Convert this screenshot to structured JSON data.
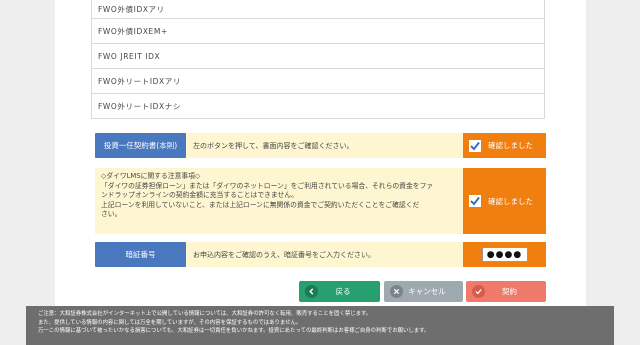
{
  "funds": [
    "FWO外債IDXアリ",
    "FWO外債IDXEM+",
    "FWO JREIT IDX",
    "FWO外リートIDXアリ",
    "FWO外リートIDXナシ"
  ],
  "contract_row": {
    "label": "投資一任契約書(本則)",
    "text": "左のボタンを押して、書面内容をご確認ください。",
    "confirm_label": "確認しました"
  },
  "notice_row": {
    "lines": [
      "◇ダイワLMSに関する注意事項◇",
      "「ダイワの証券担保ローン」または「ダイワのネットローン」をご利用されている場合、それらの資金をファ",
      "ンドラップオンラインの契約金額に充当することはできません。",
      "上記ローンを利用していないこと、または上記ローンに無関係の資金でご契約いただくことをご確認くだ",
      "さい。"
    ],
    "confirm_label": "確認しました"
  },
  "pin_row": {
    "label": "暗証番号",
    "text": "お申込内容をご確認のうえ、暗証番号をご入力ください。",
    "value": "●●●●"
  },
  "buttons": {
    "back": "戻る",
    "cancel": "キャンセル",
    "contract": "契約"
  },
  "footer": {
    "lines": [
      "ご注意：大和証券株式会社がインターネット上で公開している情報については、大和証券の許可なく転用、販売することを固く禁じます。",
      "また、提供している情報の内容に関しては万全を期していますが、その内容を保証するものではありません。",
      "万一この情報に基づいて被ったいかなる損害についても、大和証券は一切責任を負いかねます。投資にあたっての最終判断はお客様ご自身の判断でお願いします。"
    ]
  },
  "colors": {
    "label_blue": "#4a78bf",
    "confirm_orange": "#f07f10",
    "row_bg": "#fdf6d0",
    "back_green": "#25a06e",
    "cancel_gray": "#9eaab0",
    "contract_red": "#ef7a6a",
    "footer_gray": "#6e6e6e"
  }
}
